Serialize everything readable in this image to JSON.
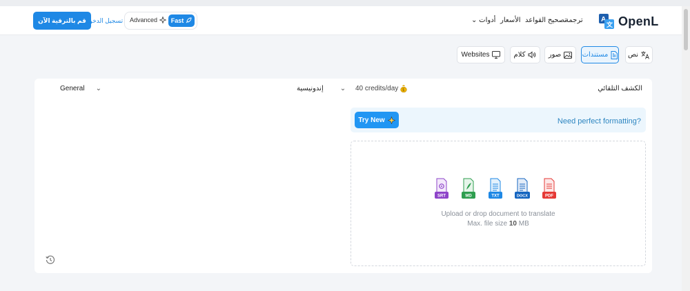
{
  "header": {
    "upgrade_label": "قم بالترقية الآن",
    "login_label": "تسجيل الدخول",
    "mode_advanced": "Advanced",
    "mode_fast": "Fast",
    "nav": {
      "tools": "أدوات",
      "pricing": "الأسعار",
      "grammar": "تصحيح القواعد",
      "translate": "ترجمة"
    },
    "logo_text": "OpenL",
    "logo_icon": "translate-logo-icon"
  },
  "tabs": [
    {
      "label": "Websites",
      "icon": "monitor-icon"
    },
    {
      "label": "كلام",
      "icon": "speaker-icon"
    },
    {
      "label": "صور",
      "icon": "image-icon"
    },
    {
      "label": "مستندات",
      "icon": "document-icon",
      "active": true
    },
    {
      "label": "نص",
      "icon": "translate-icon"
    }
  ],
  "panel": {
    "domain_select": "General",
    "target_language": "إندونيسية",
    "credits": "40 credits/day",
    "source_language": "الكشف التلقائي",
    "promo": {
      "button_label": "Try New",
      "text": "Need perfect formatting?"
    },
    "dropzone": {
      "file_types": [
        "SRT",
        "MD",
        "TXT",
        "DOCX",
        "PDF"
      ],
      "line1": "Upload or drop document to translate",
      "line2_prefix": "Max. file size",
      "line2_value": "10",
      "line2_unit": "MB"
    }
  },
  "colors": {
    "accent": "#1e88e5",
    "promo_bg": "#ecf6fd",
    "pdf": "#e53935",
    "docx": "#1565c0",
    "txt": "#1e88e5",
    "md": "#2e9e4f",
    "srt": "#8e44c9"
  }
}
